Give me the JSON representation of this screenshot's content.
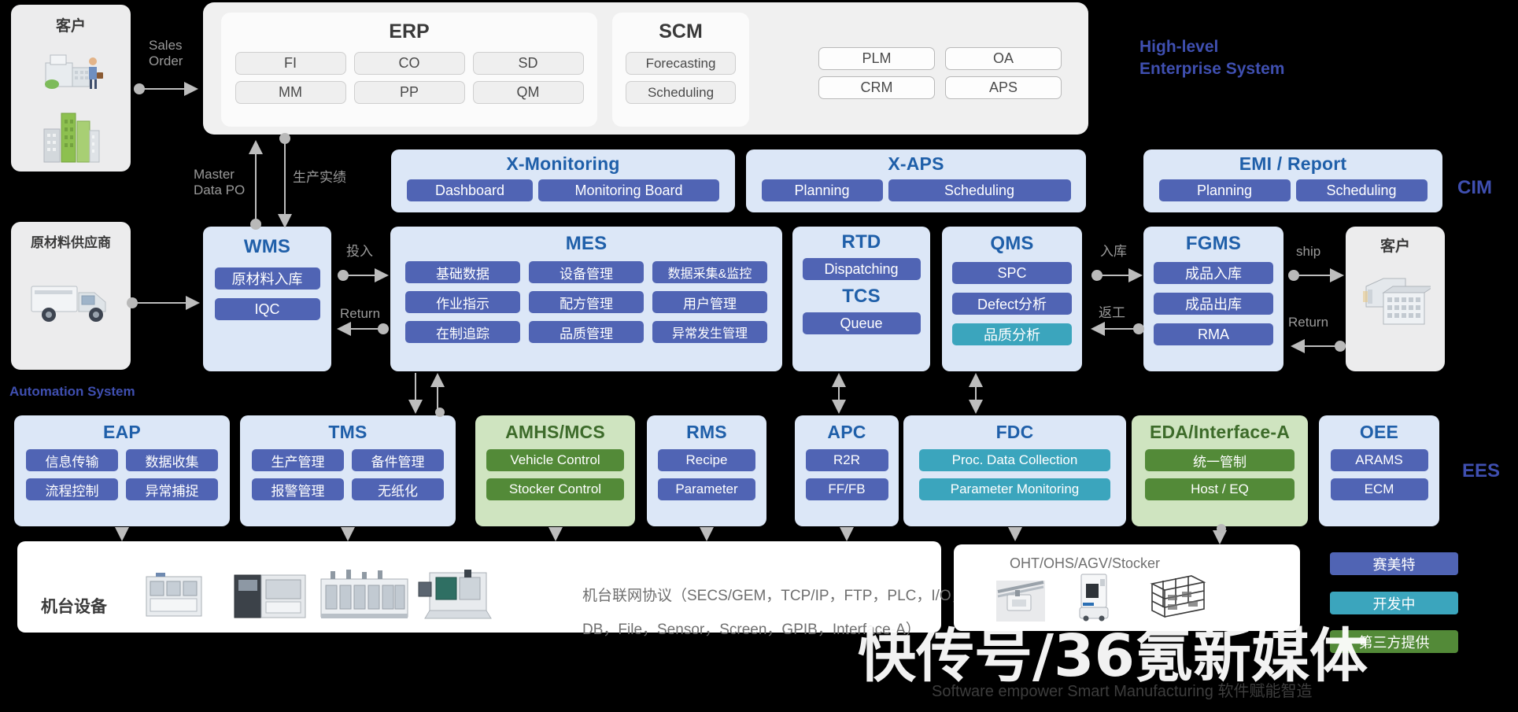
{
  "diagram": {
    "footer_note": "Software empower Smart Manufacturing  软件赋能智造",
    "watermark": "快传号/36氪新媒体"
  },
  "left_actors": {
    "customer": {
      "title": "客户",
      "icon_top": "office-building-person-icon",
      "icon_bottom": "city-buildings-icon"
    },
    "supplier": {
      "title": "原材料供应商",
      "icon": "delivery-truck-icon"
    }
  },
  "right_actors": {
    "customer": {
      "title": "客户",
      "icon": "warehouse-buildings-icon"
    }
  },
  "arrows": {
    "sales_order": "Sales\nOrder",
    "master_data_po": "Master\nData PO",
    "production_result": "生产实绩",
    "input": "投入",
    "return_left": "Return",
    "inbound": "入库",
    "rework": "返工",
    "ship": "ship",
    "return_right": "Return"
  },
  "side_labels": {
    "high_level": "High-level\nEnterprise System",
    "cim": "CIM",
    "ees": "EES",
    "automation": "Automation  System"
  },
  "enterprise": {
    "erp": {
      "title": "ERP",
      "items": [
        "FI",
        "CO",
        "SD",
        "MM",
        "PP",
        "QM"
      ]
    },
    "scm": {
      "title": "SCM",
      "items": [
        "Forecasting",
        "Scheduling"
      ]
    },
    "others": [
      "PLM",
      "OA",
      "CRM",
      "APS"
    ]
  },
  "cim_row": [
    {
      "title": "X-Monitoring",
      "items": [
        "Dashboard",
        "Monitoring Board"
      ],
      "style": "blue"
    },
    {
      "title": "X-APS",
      "items": [
        "Planning",
        "Scheduling"
      ],
      "style": "blue"
    },
    {
      "title": "EMI / Report",
      "items": [
        "Planning",
        "Scheduling"
      ],
      "style": "blue"
    }
  ],
  "core_row": {
    "wms": {
      "title": "WMS",
      "items": [
        "原材料入库",
        "IQC"
      ]
    },
    "mes": {
      "title": "MES",
      "items": [
        "基础数据",
        "设备管理",
        "数据采集&监控",
        "作业指示",
        "配方管理",
        "用户管理",
        "在制追踪",
        "品质管理",
        "异常发生管理"
      ]
    },
    "rtd": {
      "title": "RTD",
      "items": [
        "Dispatching"
      ],
      "sub_title": "TCS",
      "sub_items": [
        "Queue"
      ]
    },
    "qms": {
      "title": "QMS",
      "items": [
        {
          "label": "SPC",
          "color": "blue"
        },
        {
          "label": "Defect分析",
          "color": "blue"
        },
        {
          "label": "品质分析",
          "color": "teal"
        }
      ]
    },
    "fgms": {
      "title": "FGMS",
      "items": [
        "成品入库",
        "成品出库",
        "RMA"
      ]
    }
  },
  "ees_row": [
    {
      "title": "EAP",
      "style": "blue",
      "items": [
        {
          "label": "信息传输",
          "color": "blue"
        },
        {
          "label": "数据收集",
          "color": "blue"
        },
        {
          "label": "流程控制",
          "color": "blue"
        },
        {
          "label": "异常捕捉",
          "color": "blue"
        }
      ],
      "cols": 2
    },
    {
      "title": "TMS",
      "style": "blue",
      "items": [
        {
          "label": "生产管理",
          "color": "blue"
        },
        {
          "label": "备件管理",
          "color": "blue"
        },
        {
          "label": "报警管理",
          "color": "blue"
        },
        {
          "label": "无纸化",
          "color": "blue"
        }
      ],
      "cols": 2
    },
    {
      "title": "AMHS/MCS",
      "style": "green",
      "items": [
        {
          "label": "Vehicle Control",
          "color": "green"
        },
        {
          "label": "Stocker Control",
          "color": "green"
        }
      ],
      "cols": 1
    },
    {
      "title": "RMS",
      "style": "blue",
      "items": [
        {
          "label": "Recipe",
          "color": "blue"
        },
        {
          "label": "Parameter",
          "color": "blue"
        }
      ],
      "cols": 1
    },
    {
      "title": "APC",
      "style": "blue",
      "items": [
        {
          "label": "R2R",
          "color": "blue"
        },
        {
          "label": "FF/FB",
          "color": "blue"
        }
      ],
      "cols": 1
    },
    {
      "title": "FDC",
      "style": "blue",
      "items": [
        {
          "label": "Proc. Data  Collection",
          "color": "teal"
        },
        {
          "label": "Parameter  Monitoring",
          "color": "teal"
        }
      ],
      "cols": 1
    },
    {
      "title": "EDA/Interface-A",
      "style": "green",
      "items": [
        {
          "label": "统一管制",
          "color": "green"
        },
        {
          "label": "Host / EQ",
          "color": "green"
        }
      ],
      "cols": 1
    },
    {
      "title": "OEE",
      "style": "blue",
      "items": [
        {
          "label": "ARAMS",
          "color": "blue"
        },
        {
          "label": "ECM",
          "color": "blue"
        }
      ],
      "cols": 1
    }
  ],
  "equipment": {
    "title": "机台设备",
    "protocol_line1": "机台联网协议（SECS/GEM，TCP/IP，FTP，PLC，I/O，",
    "protocol_line2": "DB，File，Sensor，Screen，GPIB，Interface-A）",
    "machine_icons": [
      "machine-icon",
      "machine-icon",
      "machine-icon",
      "machine-icon"
    ]
  },
  "material_handling": {
    "title": "OHT/OHS/AGV/Stocker",
    "icons": [
      "oht-rail-icon",
      "agv-robot-icon",
      "stocker-rack-icon"
    ]
  },
  "legend": [
    {
      "label": "赛美特",
      "color": "#5064b4"
    },
    {
      "label": "开发中",
      "color": "#3ba5bd"
    },
    {
      "label": "第三方提供",
      "color": "#538a38"
    }
  ]
}
